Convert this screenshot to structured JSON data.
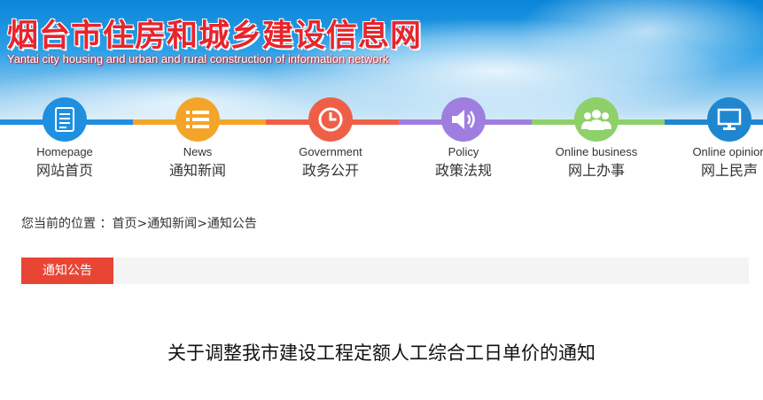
{
  "header": {
    "title": "烟台市住房和城乡建设信息网",
    "subtitle": "Yantai city housing and urban and rural construction of information network"
  },
  "nav": {
    "items": [
      {
        "en": "Homepage",
        "cn": "网站首页",
        "color": "#1f8fe0",
        "icon": "document-icon"
      },
      {
        "en": "News",
        "cn": "通知新闻",
        "color": "#f3a52a",
        "icon": "list-icon"
      },
      {
        "en": "Government",
        "cn": "政务公开",
        "color": "#ef5f48",
        "icon": "clock-icon"
      },
      {
        "en": "Policy",
        "cn": "政策法规",
        "color": "#9f7ee0",
        "icon": "speaker-icon"
      },
      {
        "en": "Online business",
        "cn": "网上办事",
        "color": "#8ed06a",
        "icon": "people-icon"
      },
      {
        "en": "Online opinion",
        "cn": "网上民声",
        "color": "#1f86d0",
        "icon": "monitor-icon"
      }
    ]
  },
  "breadcrumb": {
    "prefix": "您当前的位置 ：",
    "home": "首页",
    "sep1": ">",
    "news": "通知新闻",
    "sep2": ">",
    "current": "通知公告"
  },
  "section": {
    "tab_label": "通知公告"
  },
  "article": {
    "title": "关于调整我市建设工程定额人工综合工日单价的通知"
  }
}
